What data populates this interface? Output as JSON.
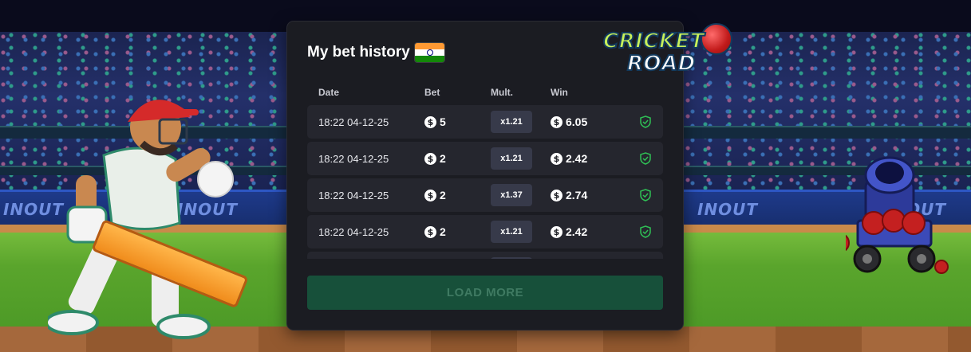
{
  "panel": {
    "title": "My bet history",
    "flag_icon": "india-flag-icon",
    "headers": {
      "date": "Date",
      "bet": "Bet",
      "mult": "Mult.",
      "win": "Win"
    },
    "rows": [
      {
        "date": "18:22 04-12-25",
        "bet": "5",
        "mult": "x1.21",
        "win": "6.05",
        "status_icon": "shield-check-icon"
      },
      {
        "date": "18:22 04-12-25",
        "bet": "2",
        "mult": "x1.21",
        "win": "2.42",
        "status_icon": "shield-check-icon"
      },
      {
        "date": "18:22 04-12-25",
        "bet": "2",
        "mult": "x1.37",
        "win": "2.74",
        "status_icon": "shield-check-icon"
      },
      {
        "date": "18:22 04-12-25",
        "bet": "2",
        "mult": "x1.21",
        "win": "2.42",
        "status_icon": "shield-check-icon"
      }
    ],
    "currency_symbol": "$",
    "load_more_label": "LOAD MORE"
  },
  "game_logo": {
    "line1": "CRICKET",
    "line2": "ROAD"
  },
  "boards": {
    "logo_text": "INOUT"
  },
  "colors": {
    "panel_bg": "#1b1c22",
    "row_bg": "#25262e",
    "mult_pill_bg": "#373a4a",
    "load_more_bg": "#17503a",
    "load_more_text": "#3f7a62",
    "shield_green": "#2fbf55"
  }
}
